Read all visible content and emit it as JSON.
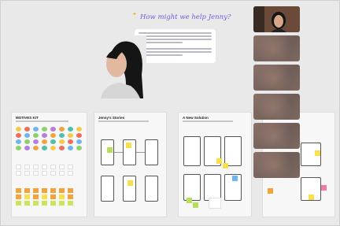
{
  "hero": {
    "title": "How might we help Jenny?"
  },
  "boards": [
    {
      "title": "MOTIVES KIT"
    },
    {
      "title": "Jenny's Stories"
    },
    {
      "title": "A New Solution"
    },
    {
      "title": ""
    }
  ],
  "video_participants": [
    "participant-1",
    "participant-2",
    "participant-3",
    "participant-4",
    "participant-5",
    "participant-6"
  ],
  "colors": {
    "accent": "#6d5fd3",
    "sticky_yellow": "#f7e04a",
    "sticky_orange": "#f4a23c",
    "sticky_green": "#b7e05a",
    "sticky_blue": "#6db6f0"
  }
}
